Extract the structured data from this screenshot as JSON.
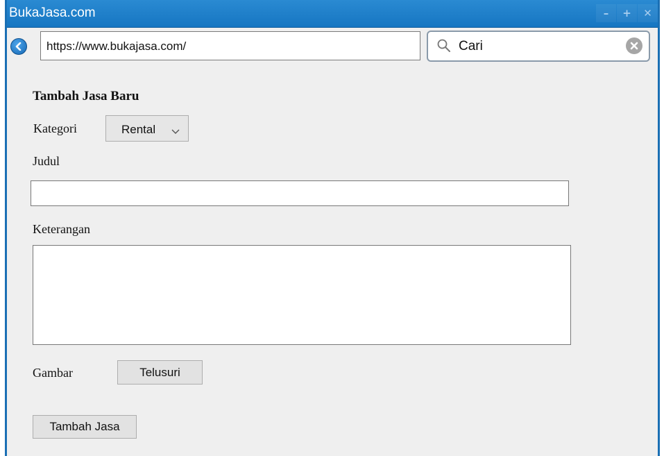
{
  "window": {
    "title": "BukaJasa.com",
    "controls": {
      "minimize": "–",
      "maximize": "+",
      "close": "✕"
    }
  },
  "nav": {
    "back_icon": "back-arrow-icon",
    "url": "https://www.bukajasa.com/",
    "search": {
      "value": "Cari",
      "icon": "search-icon",
      "clear_icon": "clear-icon"
    }
  },
  "form": {
    "title": "Tambah Jasa Baru",
    "kategori": {
      "label": "Kategori",
      "selected": "Rental"
    },
    "judul": {
      "label": "Judul",
      "value": ""
    },
    "keterangan": {
      "label": "Keterangan",
      "value": ""
    },
    "gambar": {
      "label": "Gambar",
      "button": "Telusuri"
    },
    "submit": "Tambah Jasa"
  },
  "colors": {
    "titlebar": "#1a7ac6",
    "window_bg": "#efefef",
    "accent": "#1a6fb4"
  }
}
